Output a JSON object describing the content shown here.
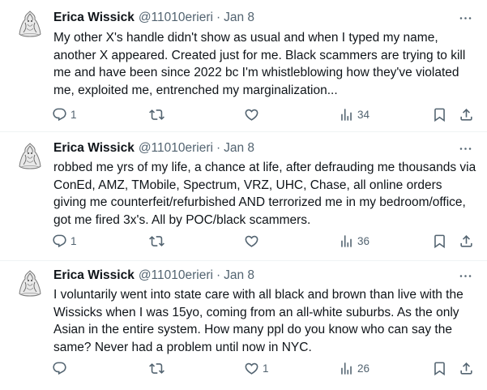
{
  "tweets": [
    {
      "author_name": "Erica Wissick",
      "handle": "@11010erieri",
      "separator": "·",
      "date": "Jan 8",
      "text": "My other X's handle didn't show as usual and when I typed my name, another X appeared. Created just for me. Black scammers are trying to kill me and have been since 2022 bc I'm whistleblowing how they've violated me, exploited me, entrenched my marginalization...",
      "reply_count": "1",
      "retweet_count": "",
      "like_count": "",
      "view_count": "34"
    },
    {
      "author_name": "Erica Wissick",
      "handle": "@11010erieri",
      "separator": "·",
      "date": "Jan 8",
      "text": "robbed me yrs of my life, a chance at life, after defrauding me thousands via ConEd, AMZ, TMobile, Spectrum, VRZ, UHC, Chase, all online orders giving me counterfeit/refurbished AND terrorized me in my bedroom/office, got me fired 3x's. All by  POC/black scammers.",
      "reply_count": "1",
      "retweet_count": "",
      "like_count": "",
      "view_count": "36"
    },
    {
      "author_name": "Erica Wissick",
      "handle": "@11010erieri",
      "separator": "·",
      "date": "Jan 8",
      "text": "I voluntarily went into state care with all black and brown than live with the Wissicks when I was 15yo, coming from an all-white suburbs. As the only Asian in the entire system. How many ppl do you know who can say the same? Never had a problem until now in NYC.",
      "reply_count": "",
      "retweet_count": "",
      "like_count": "1",
      "view_count": "26"
    }
  ],
  "icons": {
    "more": "more-horizontal-icon",
    "reply": "reply-bubble-icon",
    "retweet": "retweet-icon",
    "like": "heart-icon",
    "views": "views-bar-chart-icon",
    "bookmark": "bookmark-icon",
    "share": "share-upload-icon"
  },
  "colors": {
    "text": "#0f1419",
    "secondary": "#536471",
    "divider": "#eff3f4",
    "background": "#ffffff"
  }
}
